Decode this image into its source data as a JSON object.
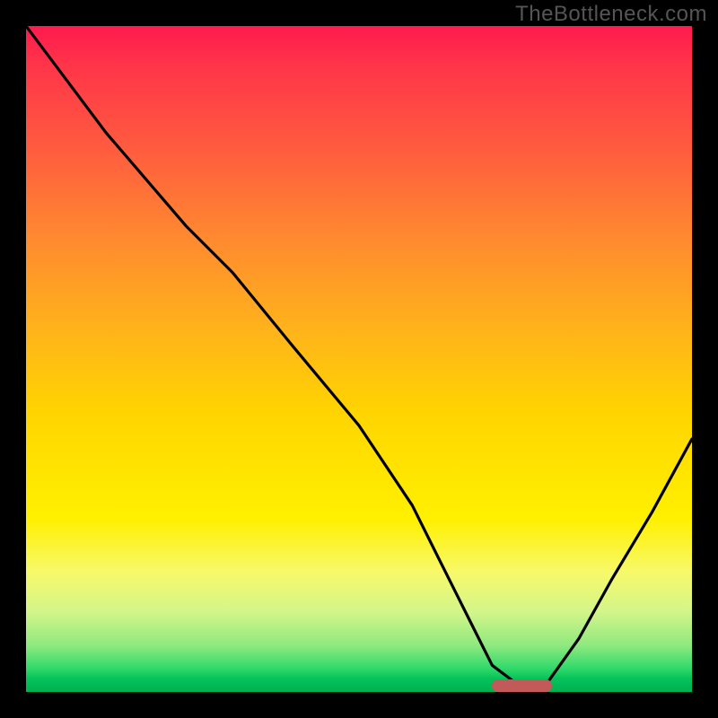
{
  "watermark": "TheBottleneck.com",
  "chart_data": {
    "type": "line",
    "title": "",
    "xlabel": "",
    "ylabel": "",
    "xlim": [
      0,
      100
    ],
    "ylim": [
      0,
      100
    ],
    "x": [
      0,
      12,
      24,
      31,
      40,
      50,
      58,
      62,
      66,
      70,
      74,
      78,
      83,
      88,
      94,
      100
    ],
    "values": [
      100,
      84,
      70,
      63,
      52,
      40,
      28,
      20,
      12,
      4,
      1,
      1,
      8,
      17,
      27,
      38
    ],
    "gradient_stops": [
      {
        "pos": 0,
        "color": "#ff1a4e"
      },
      {
        "pos": 50,
        "color": "#ffd400"
      },
      {
        "pos": 80,
        "color": "#fff000"
      },
      {
        "pos": 100,
        "color": "#00b050"
      }
    ],
    "marker": {
      "x_start": 70,
      "x_end": 79,
      "color": "#c25a5a"
    }
  }
}
